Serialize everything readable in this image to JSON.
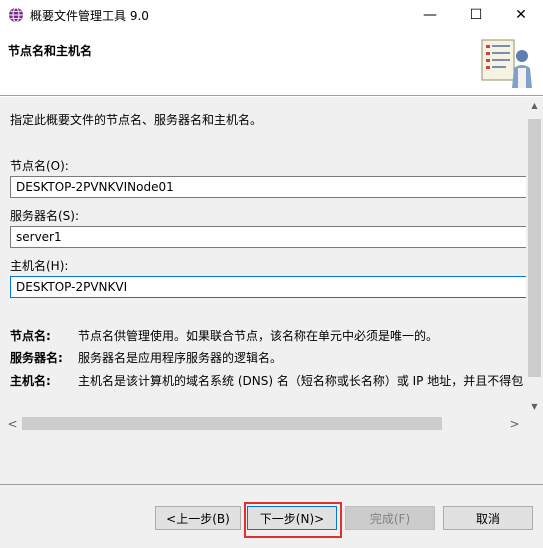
{
  "window": {
    "title": "概要文件管理工具 9.0",
    "controls": {
      "minimize": "—",
      "maximize": "☐",
      "close": "✕"
    }
  },
  "header": {
    "title": "节点名和主机名",
    "icon": "wizard-document-user-icon"
  },
  "content": {
    "description": "指定此概要文件的节点名、服务器名和主机名。",
    "fields": [
      {
        "label": "节点名(O):",
        "value": "DESKTOP-2PVNKVINode01"
      },
      {
        "label": "服务器名(S):",
        "value": "server1"
      },
      {
        "label": "主机名(H):",
        "value": "DESKTOP-2PVNKVI"
      }
    ],
    "info": [
      {
        "term": "节点名:",
        "text": "节点名供管理使用。如果联合节点，该名称在单元中必须是唯一的。"
      },
      {
        "term": "服务器名:",
        "text": "服务器名是应用程序服务器的逻辑名。"
      },
      {
        "term": "主机名:",
        "text": "主机名是该计算机的域名系统 (DNS) 名（短名称或长名称）或 IP 地址，并且不得包"
      }
    ]
  },
  "scrollbars": {
    "up": "▲",
    "down": "▼",
    "left": "<",
    "right": ">"
  },
  "buttons": {
    "back": "<上一步(B)",
    "next": "下一步(N)>",
    "finish": "完成(F)",
    "cancel": "取消"
  },
  "colors": {
    "accent": "#0078d7",
    "highlight": "#e03030"
  }
}
